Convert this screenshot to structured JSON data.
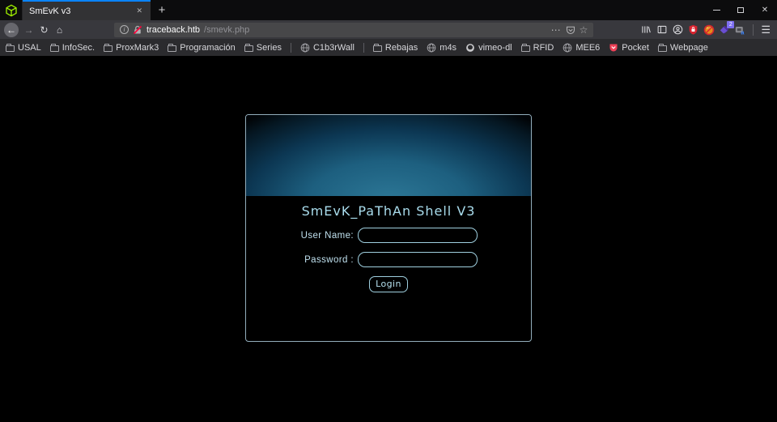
{
  "window": {
    "controls": {
      "close_glyph": "✕"
    }
  },
  "tabs": {
    "pinned_favicon": "htb-green-cube",
    "active": {
      "title": "SmEvK v3",
      "close_glyph": "✕"
    },
    "new_tab_glyph": "+"
  },
  "toolbar": {
    "back_glyph": "←",
    "forward_glyph": "→",
    "reload_glyph": "↻",
    "home_glyph": "⌂",
    "page_actions_glyph": "⋯",
    "bookmark_star_glyph": "☆",
    "menu_glyph": "☰",
    "info_glyph": "i",
    "extension_badge": "2"
  },
  "urlbar": {
    "host": "traceback.htb",
    "path": "/smevk.php"
  },
  "bookmarks": {
    "items": [
      {
        "label": "USAL",
        "icon": "folder"
      },
      {
        "label": "InfoSec.",
        "icon": "folder"
      },
      {
        "label": "ProxMark3",
        "icon": "folder"
      },
      {
        "label": "Programación",
        "icon": "folder"
      },
      {
        "label": "Series",
        "icon": "folder"
      },
      {
        "label": "C1b3rWall",
        "icon": "globe"
      },
      {
        "label": "Rebajas",
        "icon": "folder"
      },
      {
        "label": "m4s",
        "icon": "globe"
      },
      {
        "label": "vimeo-dl",
        "icon": "github"
      },
      {
        "label": "RFID",
        "icon": "folder"
      },
      {
        "label": "MEE6",
        "icon": "globe"
      },
      {
        "label": "Pocket",
        "icon": "pocket"
      },
      {
        "label": "Webpage",
        "icon": "folder"
      }
    ]
  },
  "shell_page": {
    "title": "SmEvK_PaThAn Shell V3",
    "username_label": "User Name:",
    "password_label": "Password :",
    "username_value": "",
    "password_value": "",
    "login_label": "Login"
  },
  "colors": {
    "tab_accent_blue": "#0a84ff",
    "htb_green": "#9fef00",
    "form_accent_cyan": "#a9dcec",
    "insecure_slash_red": "#ff0039",
    "pocket_red": "#ef4056",
    "ublock_red": "#d8232f"
  }
}
